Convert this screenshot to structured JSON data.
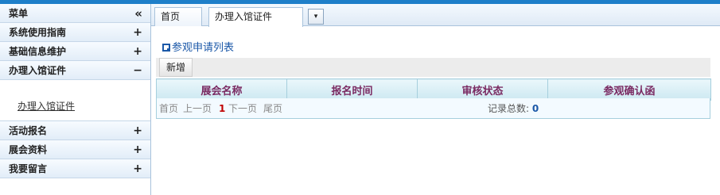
{
  "sidebar": {
    "header": {
      "label": "菜单",
      "symbol": "«"
    },
    "items": [
      {
        "label": "系统使用指南",
        "symbol": "+"
      },
      {
        "label": "基础信息维护",
        "symbol": "+"
      },
      {
        "label": "办理入馆证件",
        "symbol": "−"
      },
      {
        "label": "活动报名",
        "symbol": "+"
      },
      {
        "label": "展会资料",
        "symbol": "+"
      },
      {
        "label": "我要留言",
        "symbol": "+"
      }
    ],
    "submenu_link": "办理入馆证件"
  },
  "tabs": {
    "home": "首页",
    "active": "办理入馆证件",
    "dropdown_symbol": "▾"
  },
  "main": {
    "list_title": "参观申请列表",
    "new_button": "新增",
    "columns": [
      "展会名称",
      "报名时间",
      "审核状态",
      "参观确认函"
    ],
    "pager": {
      "first": "首页",
      "prev": "上一页",
      "current": "1",
      "next": "下一页",
      "last": "尾页",
      "total_label": "记录总数:",
      "total_value": "0"
    }
  },
  "colors": {
    "accent": "#1e7fc9",
    "header_text": "#7a2a62",
    "link": "#1b58a8"
  }
}
